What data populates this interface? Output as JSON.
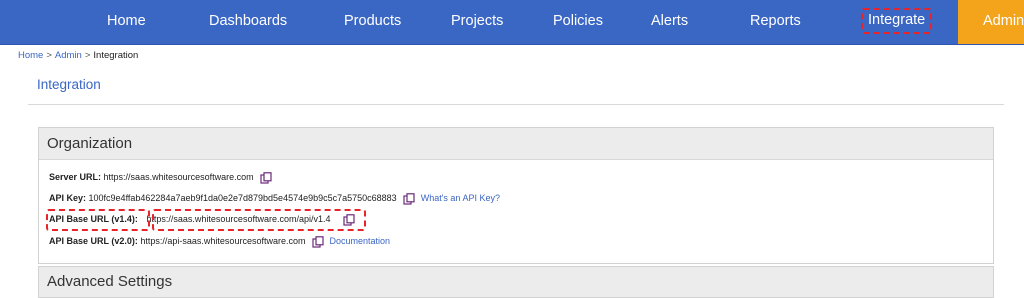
{
  "nav": {
    "items": [
      "Home",
      "Dashboards",
      "Products",
      "Projects",
      "Policies",
      "Alerts",
      "Reports",
      "Integrate"
    ],
    "admin": "Admin"
  },
  "breadcrumb": {
    "home": "Home",
    "admin": "Admin",
    "current": "Integration",
    "sep": ">"
  },
  "page": {
    "title": "Integration"
  },
  "organization": {
    "title": "Organization",
    "server_url_label": "Server URL:",
    "server_url": "https://saas.whitesourcesoftware.com",
    "api_key_label": "API Key:",
    "api_key": "100fc9e4ffab462284a7aeb9f1da0e2e7d879bd5e4574e9b9c5c7a5750c68883",
    "api_key_link": "What's an API Key?",
    "api_base_v14_label": "API Base URL (v1.4):",
    "api_base_v14": "https://saas.whitesourcesoftware.com/api/v1.4",
    "api_base_v20_label": "API Base URL (v2.0):",
    "api_base_v20": "https://api-saas.whitesourcesoftware.com",
    "documentation_link": "Documentation"
  },
  "advanced": {
    "title": "Advanced Settings"
  },
  "colors": {
    "nav_bg": "#3a66c4",
    "admin_bg": "#f3a41b",
    "highlight": "#e8232a",
    "link": "#3a66c4"
  }
}
